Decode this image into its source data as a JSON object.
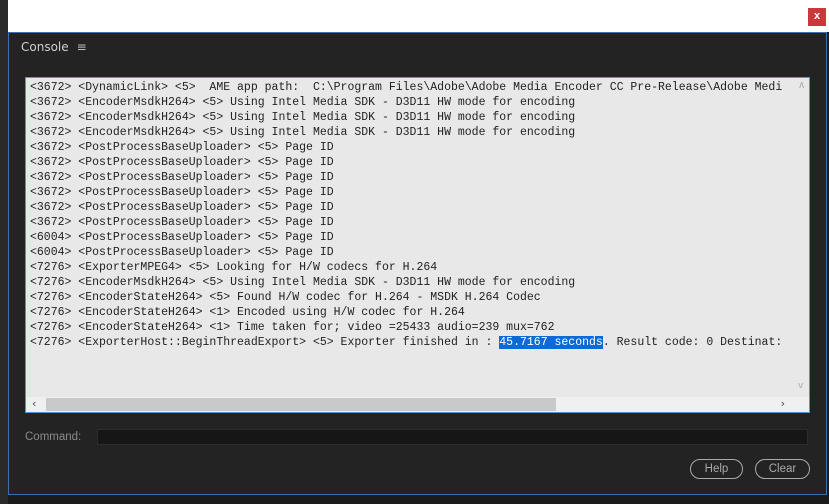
{
  "window": {
    "close_label": "x"
  },
  "console": {
    "title": "Console",
    "menu_icon": "hamburger-menu-icon",
    "lines": [
      "<3672> <DynamicLink> <5>  AME app path:  C:\\Program Files\\Adobe\\Adobe Media Encoder CC Pre-Release\\Adobe Medi",
      "<3672> <EncoderMsdkH264> <5> Using Intel Media SDK - D3D11 HW mode for encoding",
      "<3672> <EncoderMsdkH264> <5> Using Intel Media SDK - D3D11 HW mode for encoding",
      "<3672> <EncoderMsdkH264> <5> Using Intel Media SDK - D3D11 HW mode for encoding",
      "<3672> <PostProcessBaseUploader> <5> Page ID",
      "<3672> <PostProcessBaseUploader> <5> Page ID",
      "<3672> <PostProcessBaseUploader> <5> Page ID",
      "<3672> <PostProcessBaseUploader> <5> Page ID",
      "<3672> <PostProcessBaseUploader> <5> Page ID",
      "<3672> <PostProcessBaseUploader> <5> Page ID",
      "<6004> <PostProcessBaseUploader> <5> Page ID",
      "<6004> <PostProcessBaseUploader> <5> Page ID",
      "<7276> <ExporterMPEG4> <5> Looking for H/W codecs for H.264",
      "<7276> <EncoderMsdkH264> <5> Using Intel Media SDK - D3D11 HW mode for encoding",
      "<7276> <EncoderStateH264> <5> Found H/W codec for H.264 - MSDK H.264 Codec",
      "<7276> <EncoderStateH264> <1> Encoded using H/W codec for H.264",
      "<7276> <EncoderStateH264> <1> Time taken for; video =25433 audio=239 mux=762"
    ],
    "last_line": {
      "before": "<7276> <ExporterHost::BeginThreadExport> <5> Exporter finished in : ",
      "selected": "45.7167 seconds",
      "after": ". Result code: 0 Destinat:"
    }
  },
  "command": {
    "label": "Command:",
    "value": ""
  },
  "buttons": {
    "help": "Help",
    "clear": "Clear"
  },
  "colors": {
    "selection": "#0a6ad6",
    "close": "#c9393b",
    "border": "#3d6fa8"
  }
}
